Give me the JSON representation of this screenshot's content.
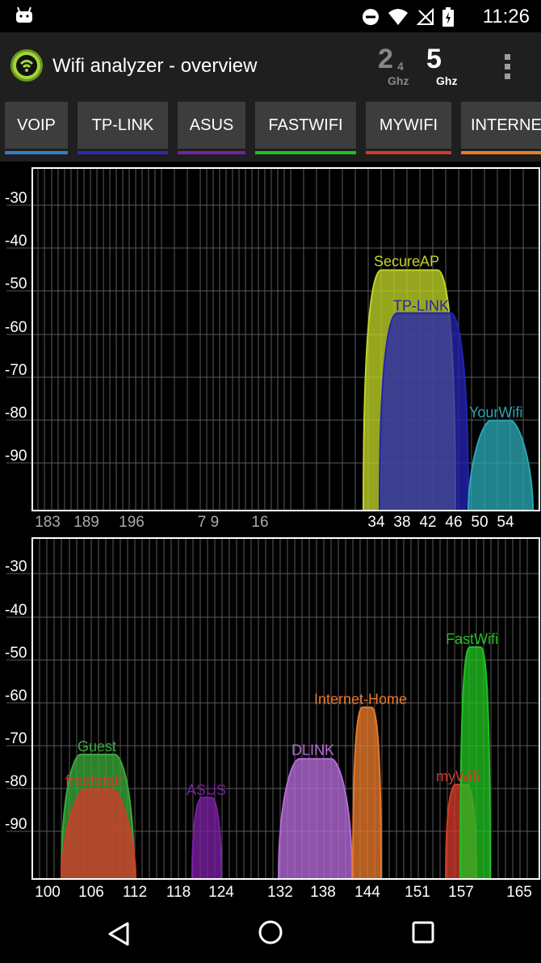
{
  "status_bar": {
    "time": "11:26",
    "icons": [
      "android-icon",
      "dnd-icon",
      "wifi-icon",
      "no-signal-icon",
      "battery-icon"
    ]
  },
  "app_bar": {
    "title": "Wifi analyzer - overview",
    "band_24": {
      "major": "2",
      "minor": "4",
      "unit": "Ghz"
    },
    "band_5": {
      "major": "5",
      "unit": "Ghz"
    }
  },
  "tabs": [
    {
      "label": "VOIP",
      "color": "#2f7fd0"
    },
    {
      "label": "TP-LINK",
      "color": "#2a2ab8"
    },
    {
      "label": "ASUS",
      "color": "#7a1fa2"
    },
    {
      "label": "FASTWIFI",
      "color": "#1ec21e"
    },
    {
      "label": "MYWIFI",
      "color": "#d03a2a"
    },
    {
      "label": "INTERNE",
      "color": "#e87b2a"
    }
  ],
  "chart_data": [
    {
      "type": "area",
      "ylabel": "",
      "xlabel": "",
      "y_ticks": [
        "-30",
        "-40",
        "-50",
        "-60",
        "-70",
        "-80",
        "-90"
      ],
      "ylim": [
        -110,
        -22
      ],
      "x_tick_labels": [
        "183",
        "189",
        "196",
        "7 9",
        "16",
        "34",
        "38",
        "42",
        "46",
        "50",
        "54"
      ],
      "grid": true,
      "series": [
        {
          "name": "SecureAP",
          "peak_dbm": -47,
          "color": "#c0d426"
        },
        {
          "name": "TP-LINK",
          "peak_dbm": -57,
          "color": "#2323b0"
        },
        {
          "name": "YourWifi",
          "peak_dbm": -82,
          "color": "#2aa6b4"
        }
      ]
    },
    {
      "type": "area",
      "ylabel": "",
      "xlabel": "",
      "y_ticks": [
        "-30",
        "-40",
        "-50",
        "-60",
        "-70",
        "-80",
        "-90"
      ],
      "ylim": [
        -110,
        -22
      ],
      "x_tick_labels": [
        "100",
        "106",
        "112",
        "118",
        "124",
        "132",
        "138",
        "144",
        "151",
        "157",
        "165"
      ],
      "grid": true,
      "series": [
        {
          "name": "Guest",
          "channel": 106,
          "peak_dbm": -74,
          "color": "#3aa83a"
        },
        {
          "name": "freefotall",
          "channel": 106,
          "peak_dbm": -82,
          "color": "#d23a2a"
        },
        {
          "name": "ASUS",
          "channel": 124,
          "peak_dbm": -84,
          "color": "#7a1fa2"
        },
        {
          "name": "DLINK",
          "channel": 138,
          "peak_dbm": -75,
          "color": "#b36ad8"
        },
        {
          "name": "Internet-Home",
          "channel": 144,
          "peak_dbm": -63,
          "color": "#e8782a"
        },
        {
          "name": "myWifi",
          "channel": 157,
          "peak_dbm": -81,
          "color": "#d23a2a"
        },
        {
          "name": "FastWifi",
          "channel": 159,
          "peak_dbm": -49,
          "color": "#20c020"
        }
      ]
    }
  ],
  "nav_bar": {
    "back": "back-icon",
    "home": "home-icon",
    "recents": "recents-icon"
  }
}
